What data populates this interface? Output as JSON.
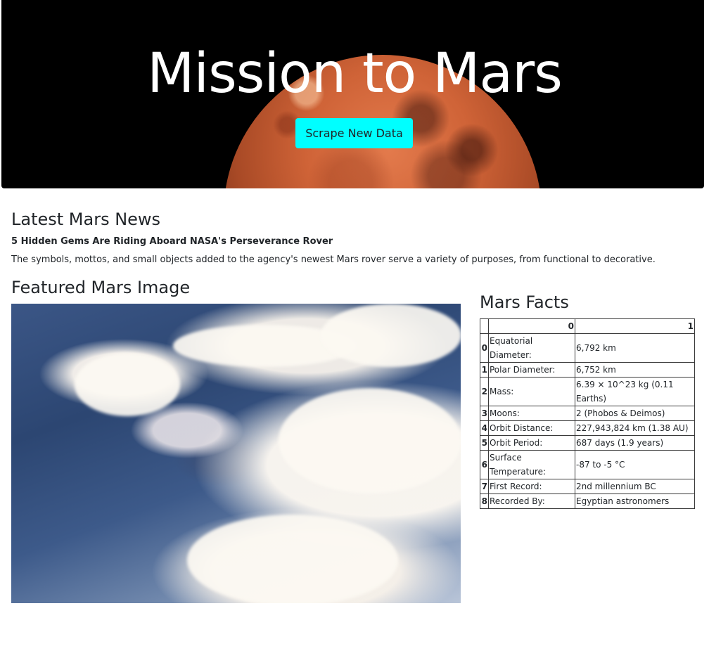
{
  "hero": {
    "title": "Mission to Mars",
    "scrape_button_label": "Scrape New Data"
  },
  "news": {
    "heading": "Latest Mars News",
    "title": "5 Hidden Gems Are Riding Aboard NASA's Perseverance Rover",
    "teaser": "The symbols, mottos, and small objects added to the agency's newest Mars rover serve a variety of purposes, from functional to decorative."
  },
  "featured": {
    "heading": "Featured Mars Image"
  },
  "facts": {
    "heading": "Mars Facts",
    "columns": [
      "0",
      "1"
    ],
    "rows": [
      {
        "index": "0",
        "label": "Equatorial Diameter:",
        "value": "6,792 km"
      },
      {
        "index": "1",
        "label": "Polar Diameter:",
        "value": "6,752 km"
      },
      {
        "index": "2",
        "label": "Mass:",
        "value": "6.39 × 10^23 kg (0.11 Earths)"
      },
      {
        "index": "3",
        "label": "Moons:",
        "value": "2 (Phobos & Deimos)"
      },
      {
        "index": "4",
        "label": "Orbit Distance:",
        "value": "227,943,824 km (1.38 AU)"
      },
      {
        "index": "5",
        "label": "Orbit Period:",
        "value": "687 days (1.9 years)"
      },
      {
        "index": "6",
        "label": "Surface Temperature:",
        "value": "-87 to -5 °C"
      },
      {
        "index": "7",
        "label": "First Record:",
        "value": "2nd millennium BC"
      },
      {
        "index": "8",
        "label": "Recorded By:",
        "value": "Egyptian astronomers"
      }
    ]
  }
}
